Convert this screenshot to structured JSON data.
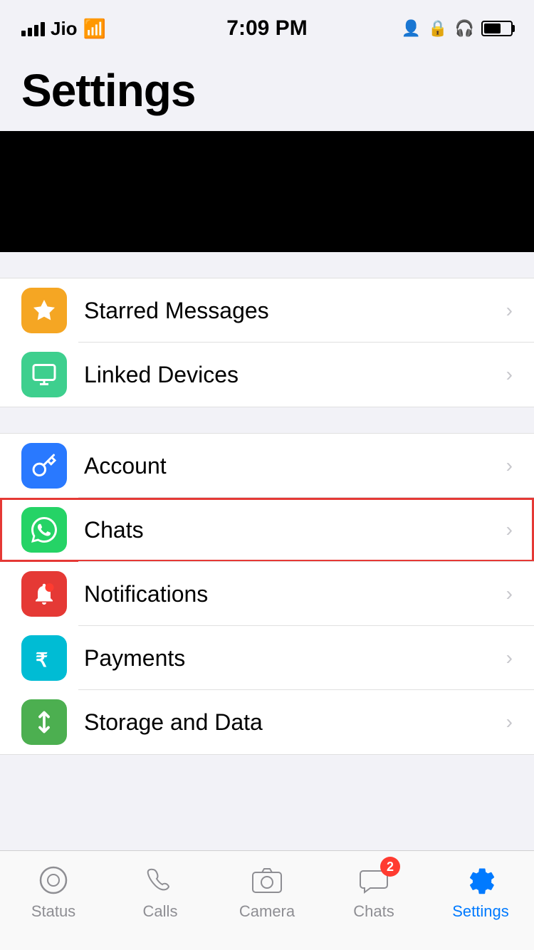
{
  "statusBar": {
    "carrier": "Jio",
    "time": "7:09 PM",
    "signalBars": [
      4,
      8,
      12,
      16,
      20
    ]
  },
  "pageTitle": "Settings",
  "groups": [
    {
      "id": "group1",
      "items": [
        {
          "id": "starred-messages",
          "label": "Starred Messages",
          "iconColor": "icon-yellow",
          "iconType": "star"
        },
        {
          "id": "linked-devices",
          "label": "Linked Devices",
          "iconColor": "icon-teal",
          "iconType": "monitor"
        }
      ]
    },
    {
      "id": "group2",
      "items": [
        {
          "id": "account",
          "label": "Account",
          "iconColor": "icon-blue",
          "iconType": "key"
        },
        {
          "id": "chats",
          "label": "Chats",
          "iconColor": "icon-green",
          "iconType": "chat",
          "highlighted": true
        },
        {
          "id": "notifications",
          "label": "Notifications",
          "iconColor": "icon-red",
          "iconType": "bell"
        },
        {
          "id": "payments",
          "label": "Payments",
          "iconColor": "icon-teal2",
          "iconType": "rupee"
        },
        {
          "id": "storage-data",
          "label": "Storage and Data",
          "iconColor": "icon-green2",
          "iconType": "arrows"
        }
      ]
    }
  ],
  "tabBar": {
    "items": [
      {
        "id": "status",
        "label": "Status",
        "icon": "status",
        "active": false,
        "badge": null
      },
      {
        "id": "calls",
        "label": "Calls",
        "icon": "calls",
        "active": false,
        "badge": null
      },
      {
        "id": "camera",
        "label": "Camera",
        "icon": "camera",
        "active": false,
        "badge": null
      },
      {
        "id": "chats",
        "label": "Chats",
        "icon": "chats",
        "active": false,
        "badge": "2"
      },
      {
        "id": "settings",
        "label": "Settings",
        "icon": "settings",
        "active": true,
        "badge": null
      }
    ]
  }
}
